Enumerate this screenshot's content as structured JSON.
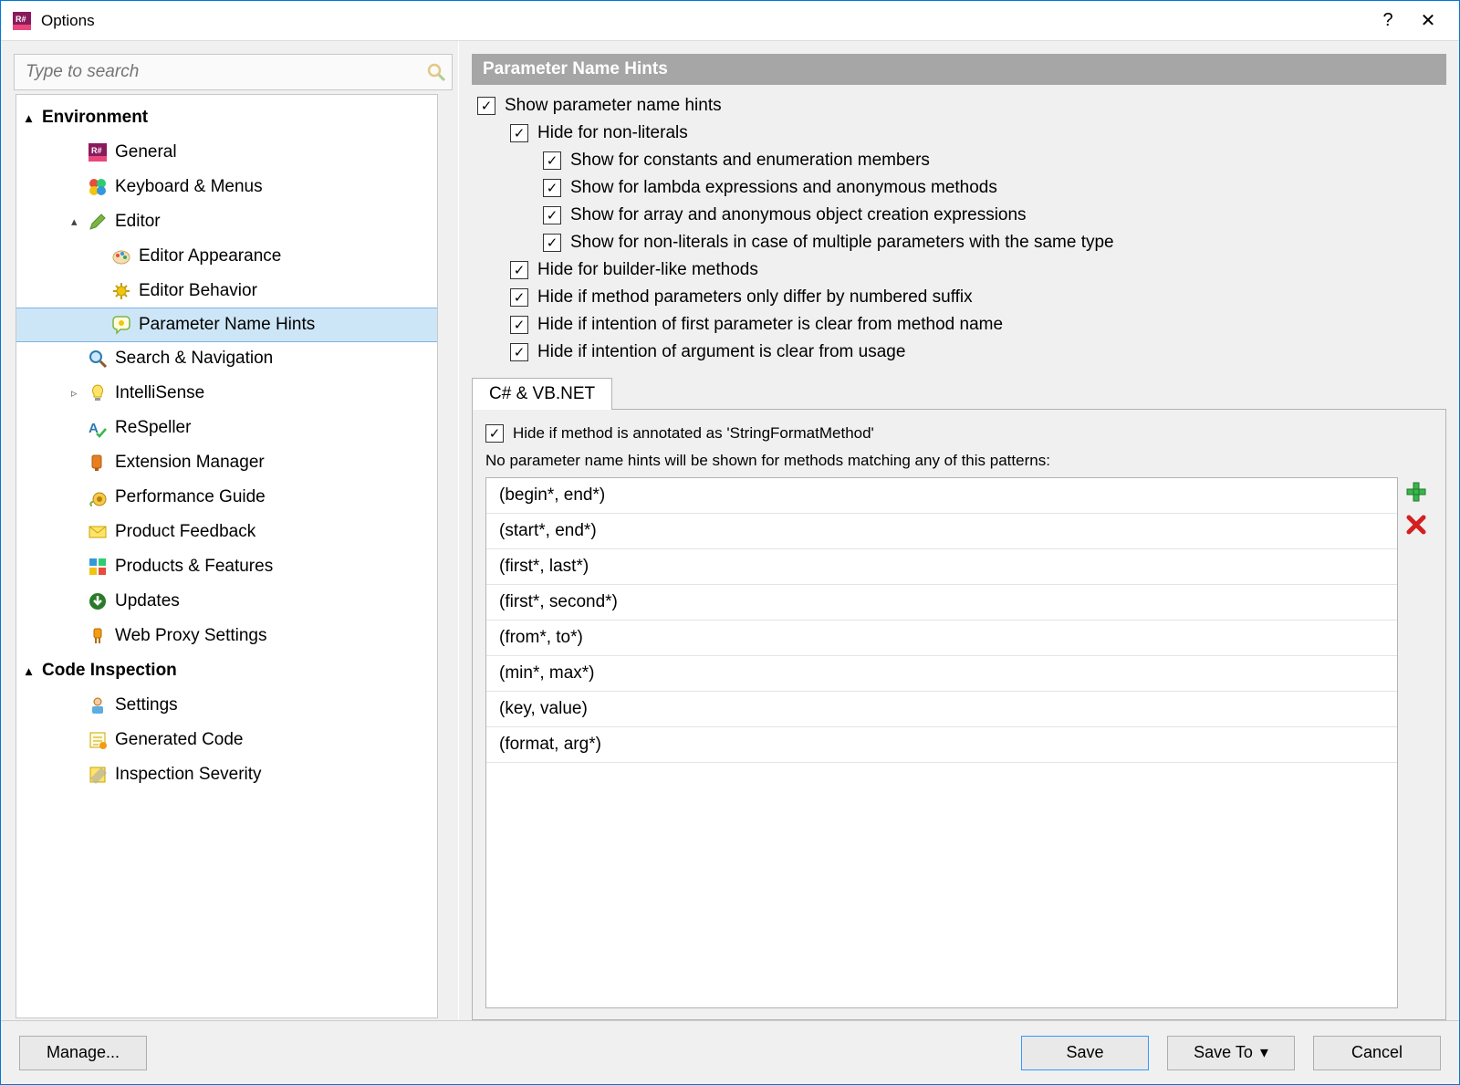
{
  "window": {
    "title": "Options",
    "help": "?",
    "close": "✕"
  },
  "search": {
    "placeholder": "Type to search"
  },
  "tree": [
    {
      "label": "Environment",
      "level": 0,
      "arrow": "▲",
      "icon": null
    },
    {
      "label": "General",
      "level": 1,
      "icon": "rsharp"
    },
    {
      "label": "Keyboard & Menus",
      "level": 1,
      "icon": "keyboard"
    },
    {
      "label": "Editor",
      "level": 1,
      "arrow": "▲",
      "icon": "pencil"
    },
    {
      "label": "Editor Appearance",
      "level": 2,
      "icon": "palette"
    },
    {
      "label": "Editor Behavior",
      "level": 2,
      "icon": "gear"
    },
    {
      "label": "Parameter Name Hints",
      "level": 2,
      "icon": "hint",
      "selected": true
    },
    {
      "label": "Search & Navigation",
      "level": 1,
      "icon": "magnifier"
    },
    {
      "label": "IntelliSense",
      "level": 1,
      "arrow": "▷",
      "icon": "bulb"
    },
    {
      "label": "ReSpeller",
      "level": 1,
      "icon": "spell"
    },
    {
      "label": "Extension Manager",
      "level": 1,
      "icon": "ext"
    },
    {
      "label": "Performance Guide",
      "level": 1,
      "icon": "snail"
    },
    {
      "label": "Product Feedback",
      "level": 1,
      "icon": "mail"
    },
    {
      "label": "Products & Features",
      "level": 1,
      "icon": "grid"
    },
    {
      "label": "Updates",
      "level": 1,
      "icon": "down"
    },
    {
      "label": "Web Proxy Settings",
      "level": 1,
      "icon": "plug"
    },
    {
      "label": "Code Inspection",
      "level": 0,
      "arrow": "▲",
      "icon": null
    },
    {
      "label": "Settings",
      "level": 1,
      "icon": "person"
    },
    {
      "label": "Generated Code",
      "level": 1,
      "icon": "gen"
    },
    {
      "label": "Inspection Severity",
      "level": 1,
      "icon": "severity"
    }
  ],
  "page": {
    "title": "Parameter Name Hints",
    "checks": [
      {
        "label": "Show parameter name hints",
        "indent": 0,
        "checked": true
      },
      {
        "label": "Hide for non-literals",
        "indent": 1,
        "checked": true
      },
      {
        "label": "Show for constants and enumeration members",
        "indent": 2,
        "checked": true
      },
      {
        "label": "Show for lambda expressions and anonymous methods",
        "indent": 2,
        "checked": true
      },
      {
        "label": "Show for array and anonymous object creation expressions",
        "indent": 2,
        "checked": true
      },
      {
        "label": "Show for non-literals in case of multiple parameters with the same type",
        "indent": 2,
        "checked": true
      },
      {
        "label": "Hide for builder-like methods",
        "indent": 1,
        "checked": true
      },
      {
        "label": "Hide if method parameters only differ by numbered suffix",
        "indent": 1,
        "checked": true
      },
      {
        "label": "Hide if intention of first parameter is clear from method name",
        "indent": 1,
        "checked": true
      },
      {
        "label": "Hide if intention of argument is clear from usage",
        "indent": 1,
        "checked": true
      }
    ],
    "tab": "C# & VB.NET",
    "tab_check": "Hide if method is annotated as 'StringFormatMethod'",
    "tab_check_checked": true,
    "patterns_intro": "No parameter name hints will be shown for methods matching any of this patterns:",
    "patterns": [
      "(begin*, end*)",
      "(start*, end*)",
      "(first*, last*)",
      "(first*, second*)",
      "(from*, to*)",
      "(min*, max*)",
      "(key, value)",
      "(format, arg*)"
    ]
  },
  "footer": {
    "manage": "Manage...",
    "save": "Save",
    "saveto": "Save To",
    "cancel": "Cancel"
  }
}
